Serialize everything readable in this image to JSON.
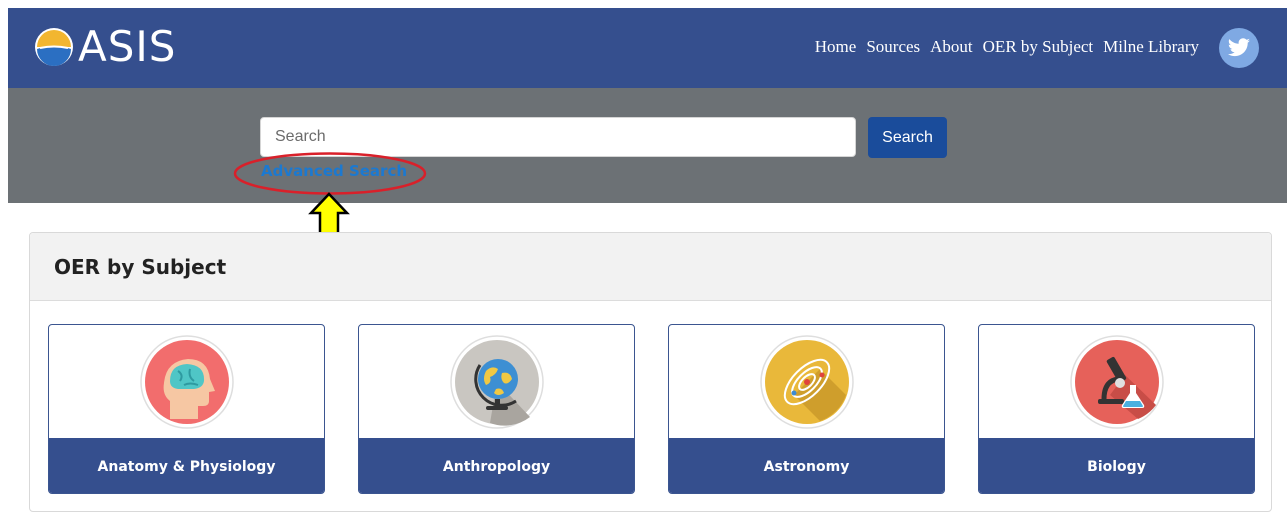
{
  "header": {
    "logo_text": "ASIS",
    "nav": [
      "Home",
      "Sources",
      "About",
      "OER by Subject",
      "Milne Library"
    ],
    "twitter_icon": "twitter-bird-icon"
  },
  "search": {
    "placeholder": "Search",
    "button_label": "Search",
    "advanced_link": "Advanced Search"
  },
  "section": {
    "title": "OER by Subject",
    "cards": [
      {
        "label": "Anatomy & Physiology",
        "icon": "brain-head-icon"
      },
      {
        "label": "Anthropology",
        "icon": "globe-icon"
      },
      {
        "label": "Astronomy",
        "icon": "solar-system-icon"
      },
      {
        "label": "Biology",
        "icon": "microscope-flask-icon"
      }
    ]
  },
  "colors": {
    "navbar": "#354f8e",
    "search_band": "#6c7175",
    "search_button": "#1a4c9b",
    "link": "#1c79d0",
    "annotation_circle": "#d9202a",
    "annotation_arrow": "#ffff00"
  }
}
